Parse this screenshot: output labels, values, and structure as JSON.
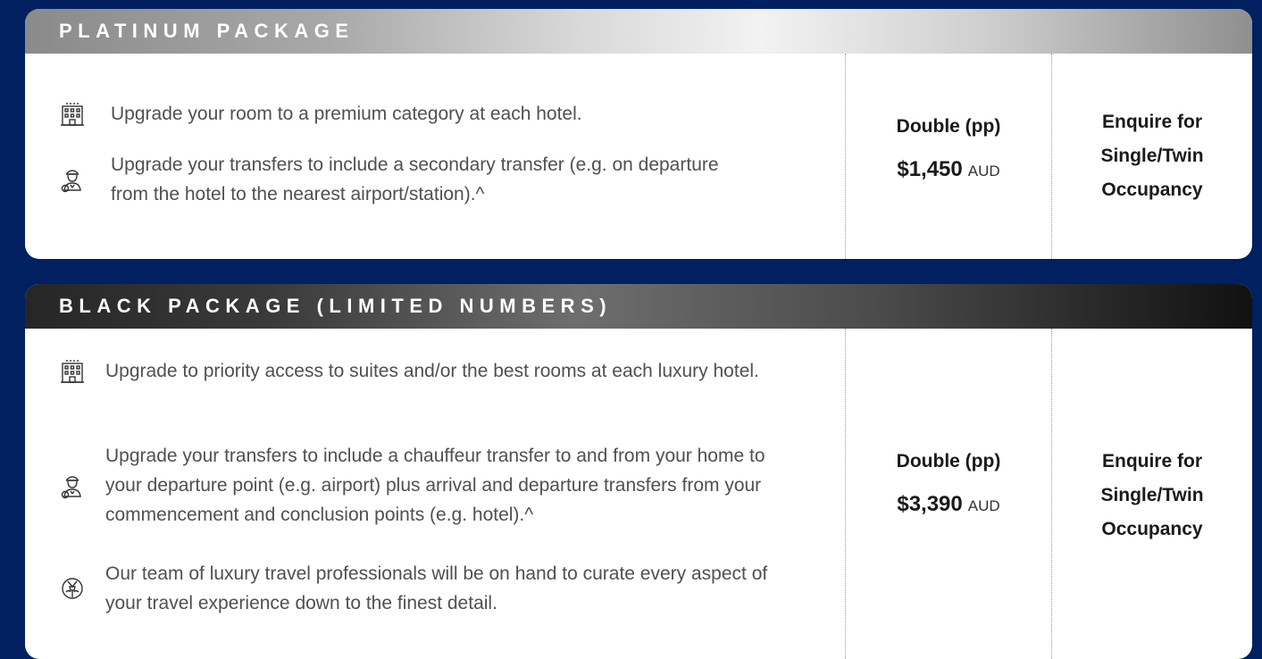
{
  "packages": [
    {
      "title": "PLATINUM PACKAGE",
      "features": [
        {
          "icon": "hotel-building-icon",
          "text": "Upgrade your room to a premium category at each hotel."
        },
        {
          "icon": "chauffeur-icon",
          "text": "Upgrade your transfers to include a secondary transfer (e.g. on departure from the hotel to the nearest airport/station).^"
        }
      ],
      "price_label": "Double (pp)",
      "price_amount": "$1,450",
      "price_currency": "AUD",
      "enquire_text": "Enquire for Single/Twin Occupancy"
    },
    {
      "title": "BLACK PACKAGE (LIMITED NUMBERS)",
      "features": [
        {
          "icon": "hotel-building-icon",
          "text": "Upgrade to priority access to suites and/or the best rooms at each luxury hotel."
        },
        {
          "icon": "chauffeur-icon",
          "text": "Upgrade your transfers to include a chauffeur transfer to and from your home to your departure point (e.g. airport) plus arrival and departure transfers from your commencement and conclusion points (e.g. hotel).^"
        },
        {
          "icon": "concierge-icon",
          "text": "Our team of luxury travel professionals will be on hand to curate every aspect of your travel experience down to the finest detail."
        }
      ],
      "price_label": "Double (pp)",
      "price_amount": "$3,390",
      "price_currency": "AUD",
      "enquire_text": "Enquire for Single/Twin Occupancy"
    }
  ],
  "colors": {
    "page_background": "#002060",
    "card_background": "#ffffff",
    "body_text": "#505050",
    "strong_text": "#1a1a1a",
    "platinum_header": "#a9a9a9",
    "black_header": "#3a3a3a"
  }
}
